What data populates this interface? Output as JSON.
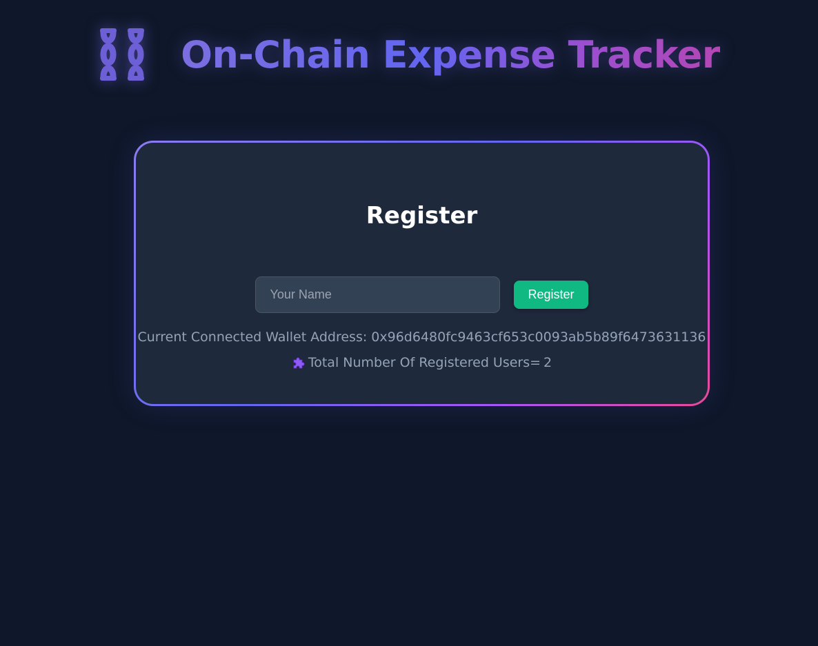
{
  "header": {
    "title": "On-Chain Expense Tracker",
    "logo_icon": "chain-link-icon"
  },
  "register_card": {
    "title": "Register",
    "name_input": {
      "placeholder": "Your Name",
      "value": ""
    },
    "register_button_label": "Register",
    "wallet_label": "Current Connected Wallet Address: ",
    "wallet_address": "0x96d6480fc9463cf653c0093ab5b89f6473631136",
    "users_icon": "puzzle-piece-icon",
    "users_label": "Total Number Of Registered Users=",
    "users_count": "2"
  },
  "colors": {
    "background": "#0f172a",
    "card": "#1e293b",
    "accent_button": "#10b981",
    "title_gradient_start": "#7c6ee0",
    "title_gradient_end": "#b447b5"
  }
}
